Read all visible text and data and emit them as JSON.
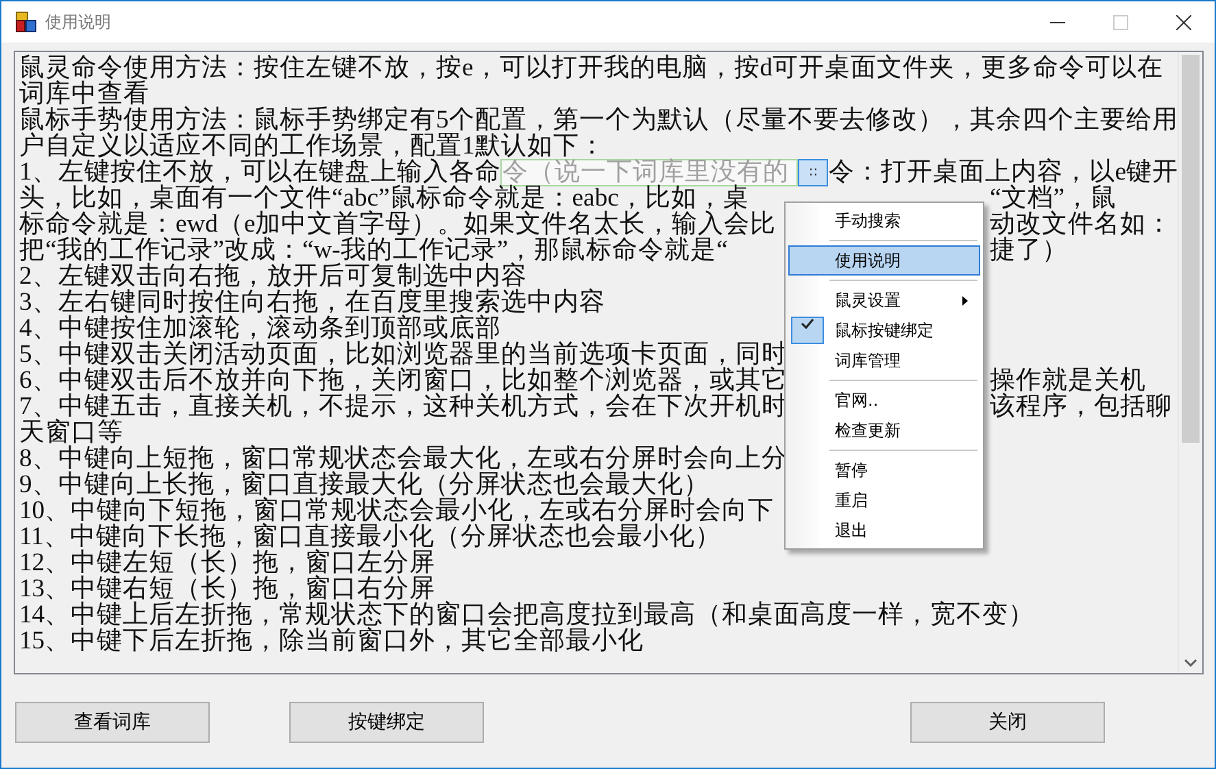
{
  "window": {
    "title": "使用说明"
  },
  "lines": [
    {
      "text": "鼠灵命令使用方法：按住左键不放，按e，可以打开我的电脑，按d可开桌面文件夹，更多命令可以在"
    },
    {
      "text": "词库中查看"
    },
    {
      "text": "鼠标手势使用方法：鼠标手势绑定有5个配置，第一个为默认（尽量不要去修改），其余四个主要给用"
    },
    {
      "text": "户自定义以适应不同的工作场景，配置1默认如下："
    },
    {
      "text": "1、左键按住不放，可以在键盘上输入各命",
      "popup": "令（说一下词库里没有的",
      "right": "令：打开桌面上内容，以e键开"
    },
    {
      "text": "头，比如，桌面有一个文件“abc”鼠标命令就是：eabc，比如，桌",
      "right": "“文档”，鼠"
    },
    {
      "text": "标命令就是：ewd（e加中文首字母）。如果文件名太长，输入会比",
      "right": "动改文件名如："
    },
    {
      "text": "把“我的工作记录”改成：“w-我的工作记录”，那鼠标命令就是“",
      "right": "捷了）"
    },
    {
      "text": "2、左键双击向右拖，放开后可复制选中内容"
    },
    {
      "text": "3、左右键同时按住向右拖，在百度里搜索选中内容"
    },
    {
      "text": "4、中键按住加滚轮，滚动条到顶部或底部"
    },
    {
      "text": "5、中键双击关闭活动页面，比如浏览器里的当前选项卡页面，同时"
    },
    {
      "text": "6、中键双击后不放并向下拖，关闭窗口，比如整个浏览器，或其它",
      "right": "操作就是关机"
    },
    {
      "text": "7、中键五击，直接关机，不提示，这种关机方式，会在下次开机时",
      "right": "该程序，包括聊"
    },
    {
      "text": "天窗口等"
    },
    {
      "text": "8、中键向上短拖，窗口常规状态会最大化，左或右分屏时会向上分"
    },
    {
      "text": "9、中键向上长拖，窗口直接最大化（分屏状态也会最大化）"
    },
    {
      "text": "10、中键向下短拖，窗口常规状态会最小化，左或右分屏时会向下"
    },
    {
      "text": "11、中键向下长拖，窗口直接最小化（分屏状态也会最小化）"
    },
    {
      "text": "12、中键左短（长）拖，窗口左分屏"
    },
    {
      "text": "13、中键右短（长）拖，窗口右分屏"
    },
    {
      "text": "14、中键上后左折拖，常规状态下的窗口会把高度拉到最高（和桌面高度一样，宽不变）"
    },
    {
      "text": "15、中键下后左折拖，除当前窗口外，其它全部最小化"
    }
  ],
  "handle": {
    "label": "::"
  },
  "menu": [
    {
      "kind": "item",
      "label": "手动搜索",
      "selected": false,
      "checked": false,
      "submenu": false
    },
    {
      "kind": "separator"
    },
    {
      "kind": "item",
      "label": "使用说明",
      "selected": true,
      "checked": false,
      "submenu": false
    },
    {
      "kind": "separator"
    },
    {
      "kind": "item",
      "label": "鼠灵设置",
      "selected": false,
      "checked": false,
      "submenu": true
    },
    {
      "kind": "item",
      "label": "鼠标按键绑定",
      "selected": false,
      "checked": true,
      "submenu": false
    },
    {
      "kind": "item",
      "label": "词库管理",
      "selected": false,
      "checked": false,
      "submenu": false
    },
    {
      "kind": "separator"
    },
    {
      "kind": "item",
      "label": "官网..",
      "selected": false,
      "checked": false,
      "submenu": false
    },
    {
      "kind": "item",
      "label": "检查更新",
      "selected": false,
      "checked": false,
      "submenu": false
    },
    {
      "kind": "separator"
    },
    {
      "kind": "item",
      "label": "暂停",
      "selected": false,
      "checked": false,
      "submenu": false
    },
    {
      "kind": "item",
      "label": "重启",
      "selected": false,
      "checked": false,
      "submenu": false
    },
    {
      "kind": "item",
      "label": "退出",
      "selected": false,
      "checked": false,
      "submenu": false
    }
  ],
  "buttons": [
    {
      "label": "查看词库"
    },
    {
      "label": "按键绑定"
    },
    {
      "label": "关闭"
    }
  ]
}
